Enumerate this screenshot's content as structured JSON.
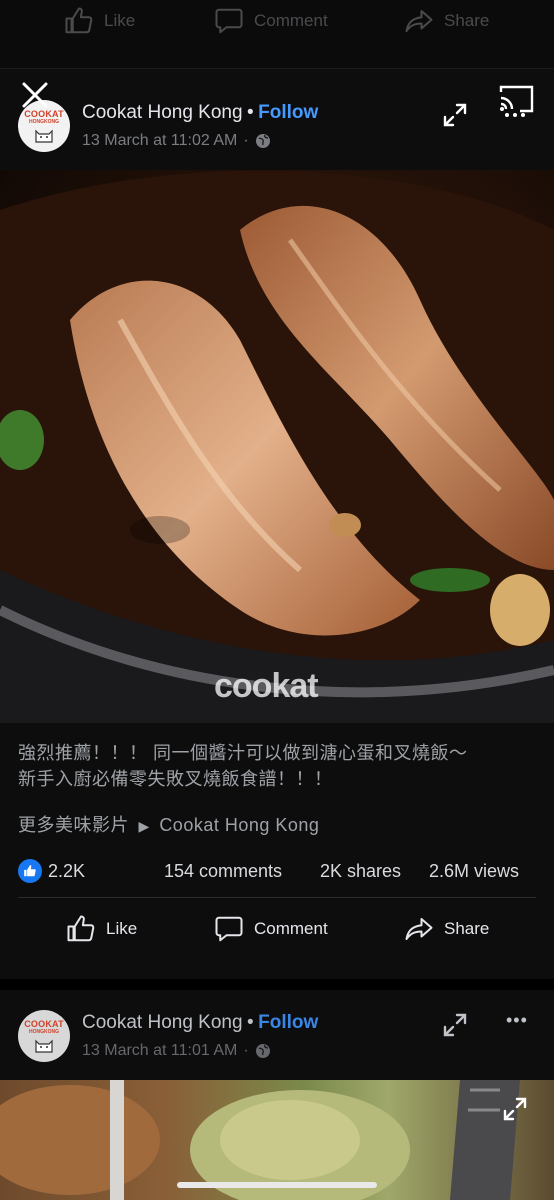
{
  "top_actions": {
    "like": "Like",
    "comment": "Comment",
    "share": "Share"
  },
  "post1": {
    "avatar_brand": "COOKAT",
    "avatar_sub": "HONGKONG",
    "author": "Cookat Hong Kong",
    "dot": "•",
    "follow": "Follow",
    "timestamp": "13 March at 11:02 AM",
    "time_sep": "·",
    "watermark": "cookat",
    "caption_line1": "強烈推薦！！！ 同一個醬汁可以做到溏心蛋和叉燒飯～",
    "caption_line2": "新手入廚必備零失敗叉燒飯食譜！！！",
    "more_videos": "更多美味影片",
    "more_arrow": "▶",
    "more_page": "Cookat Hong Kong",
    "reactions": "2.2K",
    "comments": "154 comments",
    "shares": "2K shares",
    "views": "2.6M views",
    "actions": {
      "like": "Like",
      "comment": "Comment",
      "share": "Share"
    }
  },
  "post2": {
    "avatar_brand": "COOKAT",
    "avatar_sub": "HONGKONG",
    "author": "Cookat Hong Kong",
    "dot": "•",
    "follow": "Follow",
    "timestamp": "13 March at 11:01 AM",
    "time_sep": "·",
    "more_icon": "•••"
  },
  "colors": {
    "accent": "#4599ff",
    "like_blue": "#1877f2",
    "background": "#000000"
  }
}
